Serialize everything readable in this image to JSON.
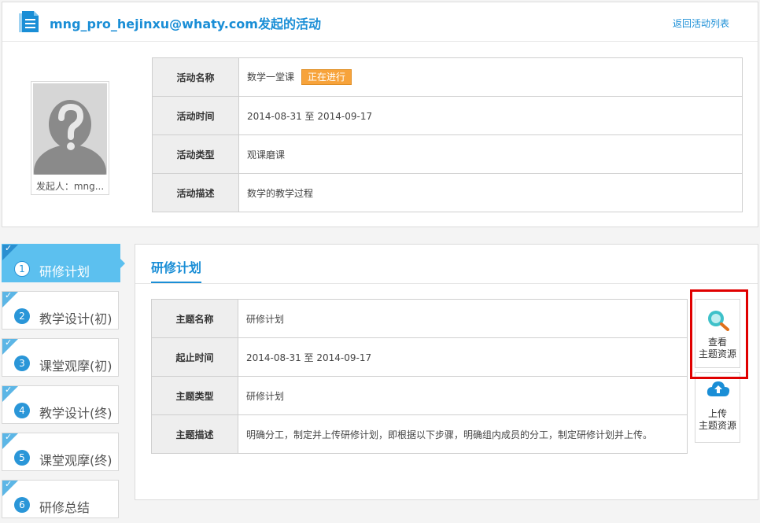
{
  "header": {
    "icon": "document-icon",
    "title": "mng_pro_hejinxu@whaty.com发起的活动",
    "back_label": "返回活动列表"
  },
  "avatar": {
    "icon": "unknown-user-avatar",
    "caption": "发起人：mng..."
  },
  "activity": {
    "name_label": "活动名称",
    "name_value": "数学一堂课",
    "status": "正在进行",
    "time_label": "活动时间",
    "time_value": "2014-08-31 至  2014-09-17",
    "type_label": "活动类型",
    "type_value": "观课磨课",
    "desc_label": "活动描述",
    "desc_value": "数学的教学过程"
  },
  "steps": [
    {
      "num": "1",
      "label": "研修计划",
      "active": true
    },
    {
      "num": "2",
      "label": "教学设计(初)"
    },
    {
      "num": "3",
      "label": "课堂观摩(初)"
    },
    {
      "num": "4",
      "label": "教学设计(终)"
    },
    {
      "num": "5",
      "label": "课堂观摩(终)"
    },
    {
      "num": "6",
      "label": "研修总结"
    }
  ],
  "main": {
    "section_title": "研修计划",
    "topic_name_label": "主题名称",
    "topic_name_value": "研修计划",
    "period_label": "起止时间",
    "period_value": "2014-08-31 至  2014-09-17",
    "topic_type_label": "主题类型",
    "topic_type_value": "研修计划",
    "topic_desc_label": "主题描述",
    "topic_desc_value": "明确分工，制定并上传研修计划，即根据以下步骤，明确组内成员的分工，制定研修计划并上传。"
  },
  "resources": {
    "view_line1": "查看",
    "view_line2": "主题资源",
    "upload_line1": "上传",
    "upload_line2": "主题资源"
  },
  "colors": {
    "accent": "#1a8ed6",
    "step_active": "#5cc0ef",
    "status_badge": "#f7a33b",
    "highlight": "#e00000"
  }
}
